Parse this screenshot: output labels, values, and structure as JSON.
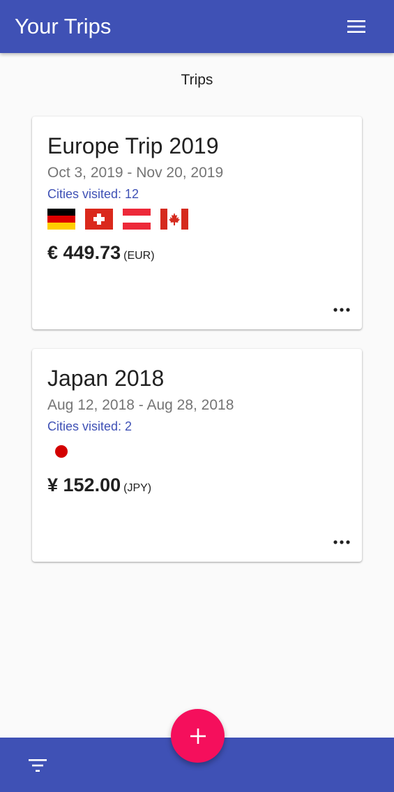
{
  "app_bar": {
    "title": "Your Trips",
    "menu_icon": "hamburger-menu-icon"
  },
  "section_title": "Trips",
  "trips": [
    {
      "name": "Europe Trip 2019",
      "dates": "Oct 3, 2019 - Nov 20, 2019",
      "cities": "Cities visited: 12",
      "flags": [
        "germany",
        "switzerland",
        "austria",
        "canada"
      ],
      "amount": "€ 449.73",
      "currency": "(EUR)",
      "more_icon": "more-horizontal-icon"
    },
    {
      "name": "Japan 2018",
      "dates": "Aug 12, 2018 - Aug 28, 2018",
      "cities": "Cities visited: 2",
      "flags": [
        "japan"
      ],
      "amount": "¥ 152.00",
      "currency": "(JPY)",
      "more_icon": "more-horizontal-icon"
    }
  ],
  "bottom_bar": {
    "filter_icon": "filter-list-icon"
  },
  "fab": {
    "icon": "add-icon"
  },
  "colors": {
    "primary": "#3f51b5",
    "accent": "#f50f5c",
    "background": "#fafafa",
    "link_text": "#3f51b5",
    "secondary_text": "#757575"
  }
}
